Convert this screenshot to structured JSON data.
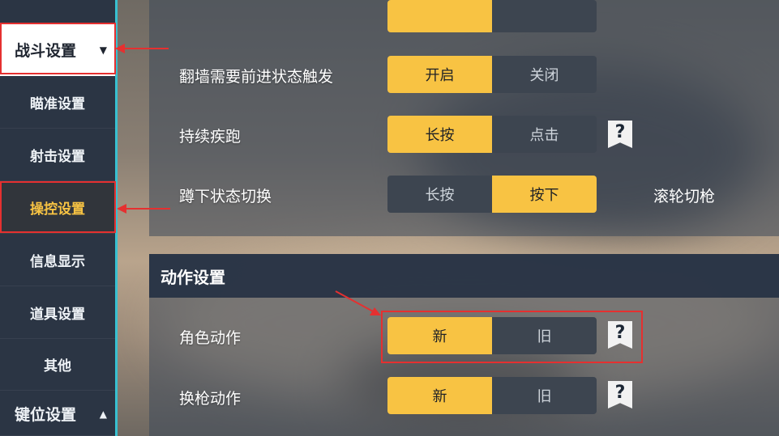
{
  "sidebar": {
    "items": [
      {
        "label": "战斗设置"
      },
      {
        "label": "瞄准设置"
      },
      {
        "label": "射击设置"
      },
      {
        "label": "操控设置"
      },
      {
        "label": "信息显示"
      },
      {
        "label": "道具设置"
      },
      {
        "label": "其他"
      },
      {
        "label": "键位设置"
      }
    ],
    "top_caret": "▼",
    "bottom_caret": "▲"
  },
  "settings_top": {
    "rows": [
      {
        "label": "翻墙需要前进状态触发",
        "options": [
          "开启",
          "关闭"
        ],
        "selected": 0
      },
      {
        "label": "持续疾跑",
        "options": [
          "长按",
          "点击"
        ],
        "selected": 0,
        "help": "?"
      },
      {
        "label": "蹲下状态切换",
        "options": [
          "长按",
          "按下"
        ],
        "selected": 1,
        "extra": "滚轮切枪"
      }
    ]
  },
  "action_section": {
    "title": "动作设置",
    "rows": [
      {
        "label": "角色动作",
        "options": [
          "新",
          "旧"
        ],
        "selected": 0,
        "help": "?"
      },
      {
        "label": "换枪动作",
        "options": [
          "新",
          "旧"
        ],
        "selected": 0,
        "help": "?"
      }
    ]
  },
  "colors": {
    "accent": "#f8c343",
    "sidebar_bg": "#2b3544",
    "annotation_red": "#e53030",
    "sidebar_edge": "#38c0d0"
  }
}
